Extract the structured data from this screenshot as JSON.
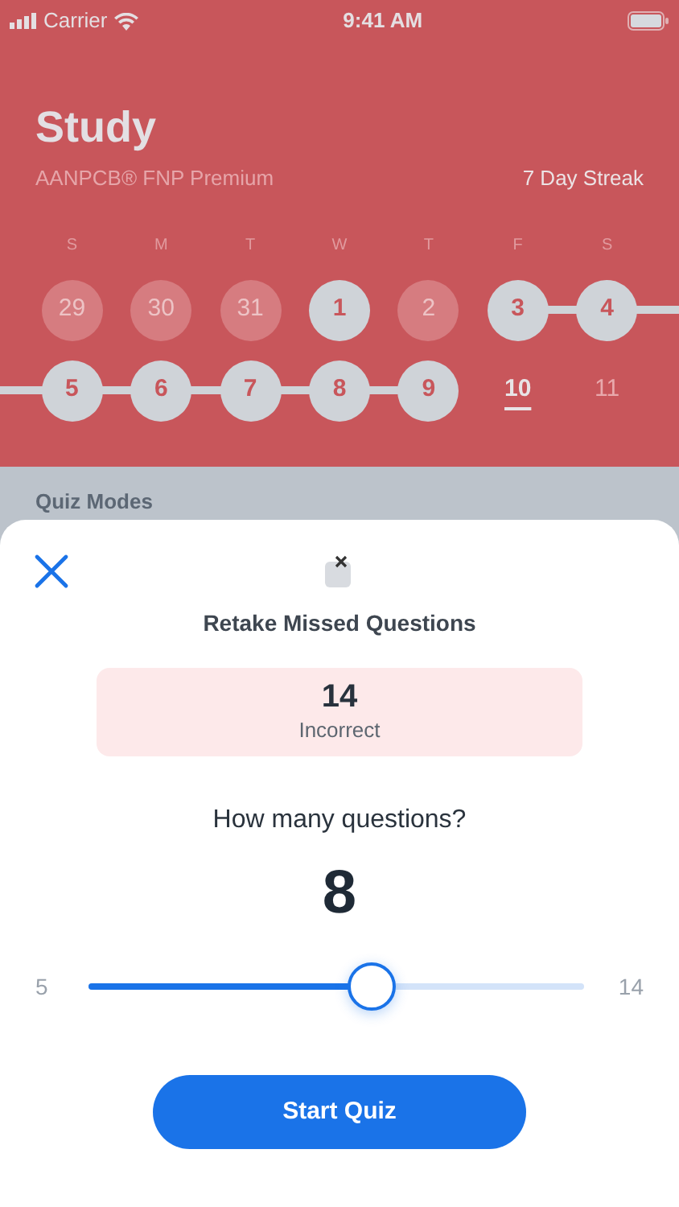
{
  "status_bar": {
    "carrier": "Carrier",
    "time": "9:41 AM"
  },
  "header": {
    "title": "Study",
    "subtitle": "AANPCB® FNP Premium",
    "streak": "7 Day Streak"
  },
  "weekdays": [
    "S",
    "M",
    "T",
    "W",
    "T",
    "F",
    "S"
  ],
  "weeks": [
    [
      {
        "day": "29",
        "kind": "missed"
      },
      {
        "day": "30",
        "kind": "missed"
      },
      {
        "day": "31",
        "kind": "missed"
      },
      {
        "day": "1",
        "kind": "studied"
      },
      {
        "day": "2",
        "kind": "missed"
      },
      {
        "day": "3",
        "kind": "studied"
      },
      {
        "day": "4",
        "kind": "studied"
      }
    ],
    [
      {
        "day": "5",
        "kind": "studied"
      },
      {
        "day": "6",
        "kind": "studied"
      },
      {
        "day": "7",
        "kind": "studied"
      },
      {
        "day": "8",
        "kind": "studied"
      },
      {
        "day": "9",
        "kind": "studied"
      },
      {
        "day": "10",
        "kind": "today"
      },
      {
        "day": "11",
        "kind": "future"
      }
    ]
  ],
  "section_title": "Quiz Modes",
  "sheet": {
    "title": "Retake Missed Questions",
    "count": "14",
    "count_label": "Incorrect",
    "question": "How many questions?",
    "value": "8",
    "slider": {
      "min": "5",
      "max": "14",
      "level": 0.57
    },
    "button": "Start Quiz"
  }
}
